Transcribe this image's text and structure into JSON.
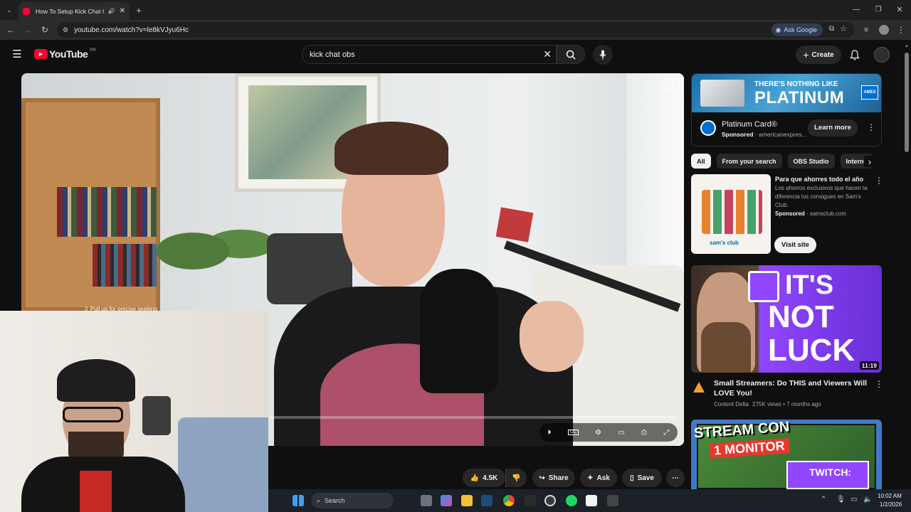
{
  "browser": {
    "tab_title": "How To Setup Kick Chat In",
    "url": "youtube.com/watch?v=le8kVJyu6Hc",
    "ask_google": "Ask Google"
  },
  "youtube": {
    "logo_text": "YouTube",
    "region": "PR",
    "search_value": "kick chat obs",
    "create_label": "Create"
  },
  "player": {
    "seek_hint": "⇳ Pull up for precise seeking"
  },
  "actions": {
    "likes": "4.5K",
    "share": "Share",
    "ask": "Ask",
    "save": "Save"
  },
  "ad": {
    "banner_line1": "THERE'S NOTHING LIKE",
    "banner_line2": "PLATINUM",
    "amex": "AMEX",
    "title": "Platinum Card®",
    "sponsored": "Sponsored",
    "advertiser": "americanexpres...",
    "cta": "Learn more"
  },
  "chips": [
    "All",
    "From your search",
    "OBS Studio",
    "Interne"
  ],
  "promo": {
    "title": "Para que ahorres todo el año",
    "description": "Los ahorros exclusivos que hacen la diferencia los consigues en Sam's Club.",
    "sponsored": "Sponsored",
    "domain": "samsclub.com",
    "cta": "Visit site",
    "brand": "sam's club"
  },
  "videos": [
    {
      "thumb_line1": "IT'S",
      "thumb_line2": "NOT",
      "thumb_line3": "LUCK",
      "duration": "11:19",
      "title": "Small Streamers: Do THIS and Viewers Will LOVE You!",
      "channel": "Content Delta",
      "meta": "275K views • 7 months ago"
    },
    {
      "thumb_line1": "STREAM CON",
      "thumb_line2": "1 MONITOR",
      "thumb_line3": "TWITCH:"
    }
  ],
  "taskbar": {
    "search_placeholder": "Search",
    "time": "10:02 AM",
    "date": "1/2/2026"
  },
  "colors": {
    "yt_red": "#ff0033",
    "twitch_purple": "#9146ff",
    "amex_blue": "#006fcf"
  }
}
